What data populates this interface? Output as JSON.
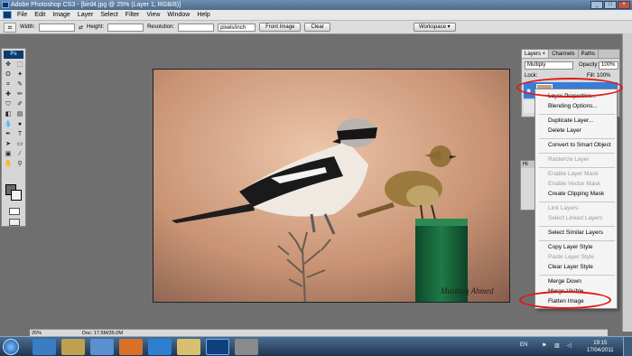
{
  "window": {
    "title": "Adobe Photoshop CS3 - [bird4.jpg @ 25% (Layer 1, RGB/8)]"
  },
  "menu": {
    "items": [
      "File",
      "Edit",
      "Image",
      "Layer",
      "Select",
      "Filter",
      "View",
      "Window",
      "Help"
    ]
  },
  "options": {
    "width_label": "Width:",
    "height_label": "Height:",
    "resolution_label": "Resolution:",
    "resolution_unit": "pixels/inch",
    "front_image": "Front Image",
    "clear": "Clear",
    "workspace": "Workspace ▾"
  },
  "layers_panel": {
    "tabs": [
      "Layers ×",
      "Channels",
      "Paths"
    ],
    "blend_mode": "Multiply",
    "opacity_label": "Opacity:",
    "opacity_value": "100%",
    "lock_label": "Lock:",
    "fill_label": "Fill:",
    "fill_value": "100%"
  },
  "history_tab": "Hi",
  "context_menu": {
    "items": [
      {
        "label": "Layer Properties...",
        "enabled": true
      },
      {
        "label": "Blending Options...",
        "enabled": true
      },
      {
        "label": "Duplicate Layer...",
        "enabled": true
      },
      {
        "label": "Delete Layer",
        "enabled": true
      },
      {
        "label": "Convert to Smart Object",
        "enabled": true
      },
      {
        "label": "Rasterize Layer",
        "enabled": false
      },
      {
        "label": "Enable Layer Mask",
        "enabled": false
      },
      {
        "label": "Enable Vector Mask",
        "enabled": false
      },
      {
        "label": "Create Clipping Mask",
        "enabled": true
      },
      {
        "label": "Link Layers",
        "enabled": false
      },
      {
        "label": "Select Linked Layers",
        "enabled": false
      },
      {
        "label": "Select Similar Layers",
        "enabled": true
      },
      {
        "label": "Copy Layer Style",
        "enabled": true
      },
      {
        "label": "Paste Layer Style",
        "enabled": false
      },
      {
        "label": "Clear Layer Style",
        "enabled": true
      },
      {
        "label": "Merge Down",
        "enabled": true
      },
      {
        "label": "Merge Visible",
        "enabled": true
      },
      {
        "label": "Flatten Image",
        "enabled": true
      }
    ]
  },
  "photo": {
    "signature": "Mushtaq Ahmed"
  },
  "status": {
    "zoom": "25%",
    "doc": "Doc: 17.5M/35.0M"
  },
  "taskbar": {
    "lang": "EN",
    "time": "19:15",
    "date": "17/04/2011"
  },
  "colors": {
    "highlight": "#3a7dd9",
    "annotation": "#e01818"
  }
}
